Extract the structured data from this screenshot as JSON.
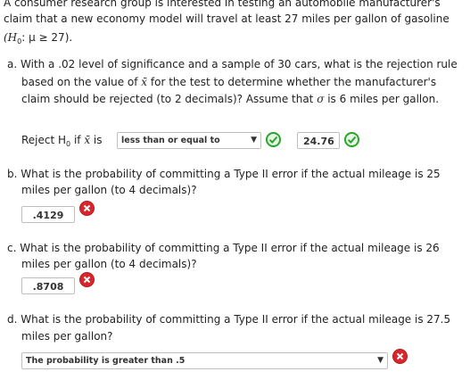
{
  "intro": {
    "line1": "A consumer research group is interested in testing an automobile manufacturer's",
    "line2": "claim that a new economy model will travel at least 27 miles per gallon of gasoline",
    "h0_pre": "(H",
    "h0_sub": "0",
    "h0_mid": ": μ ≥ 27)."
  },
  "part_a": {
    "line1_pre": "a. With a .02 level of significance and a sample of 30 cars, what is the rejection rule",
    "line2_pre": "based on the value of ",
    "xbar": "x̄",
    "line2_post": " for the test to determine whether the manufacturer's",
    "line3_pre": "claim should be rejected (to 2 decimals)? Assume that ",
    "sigma": "σ",
    "line3_post": " is 6 miles per gallon.",
    "reject_pre": "Reject H",
    "reject_sub": "0",
    "reject_if": " if ",
    "reject_is": " is",
    "select_value": "less than or equal to",
    "answer": "24.76"
  },
  "part_b": {
    "line1": "b. What is the probability of committing a Type II error if the actual mileage is 25",
    "line2": "miles per gallon (to 4 decimals)?",
    "answer": ".4129"
  },
  "part_c": {
    "line1": "c. What is the probability of committing a Type II error if the actual mileage is 26",
    "line2": "miles per gallon (to 4 decimals)?",
    "answer": ".8708"
  },
  "part_d": {
    "line1": "d. What is the probability of committing a Type II error if the actual mileage is 27.5",
    "line2": "miles per gallon?",
    "select_value": "The probability is greater than .5"
  },
  "colors": {
    "correct": "#2aa52a",
    "incorrect": "#d9262b"
  }
}
